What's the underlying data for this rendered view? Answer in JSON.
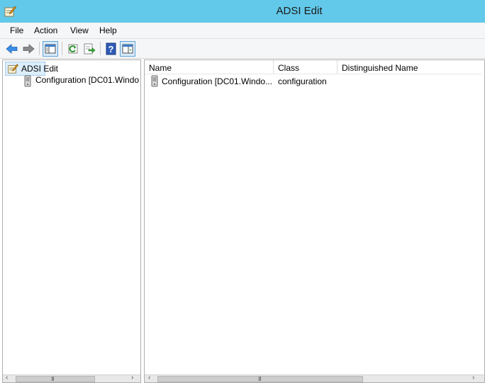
{
  "window": {
    "title": "ADSI Edit"
  },
  "menu": [
    "File",
    "Action",
    "View",
    "Help"
  ],
  "toolbar": {
    "buttons": [
      "back-icon",
      "forward-icon",
      "show-hide-console-tree-icon",
      "refresh-icon",
      "export-list-icon",
      "help-icon",
      "show-hide-action-pane-icon"
    ]
  },
  "tree": {
    "root": "ADSI Edit",
    "children": [
      "Configuration [DC01.Windo"
    ]
  },
  "list": {
    "columns": [
      "Name",
      "Class",
      "Distinguished Name"
    ],
    "rows": [
      {
        "name": "Configuration [DC01.Windo...",
        "class": "configuration",
        "dn": ""
      }
    ]
  }
}
